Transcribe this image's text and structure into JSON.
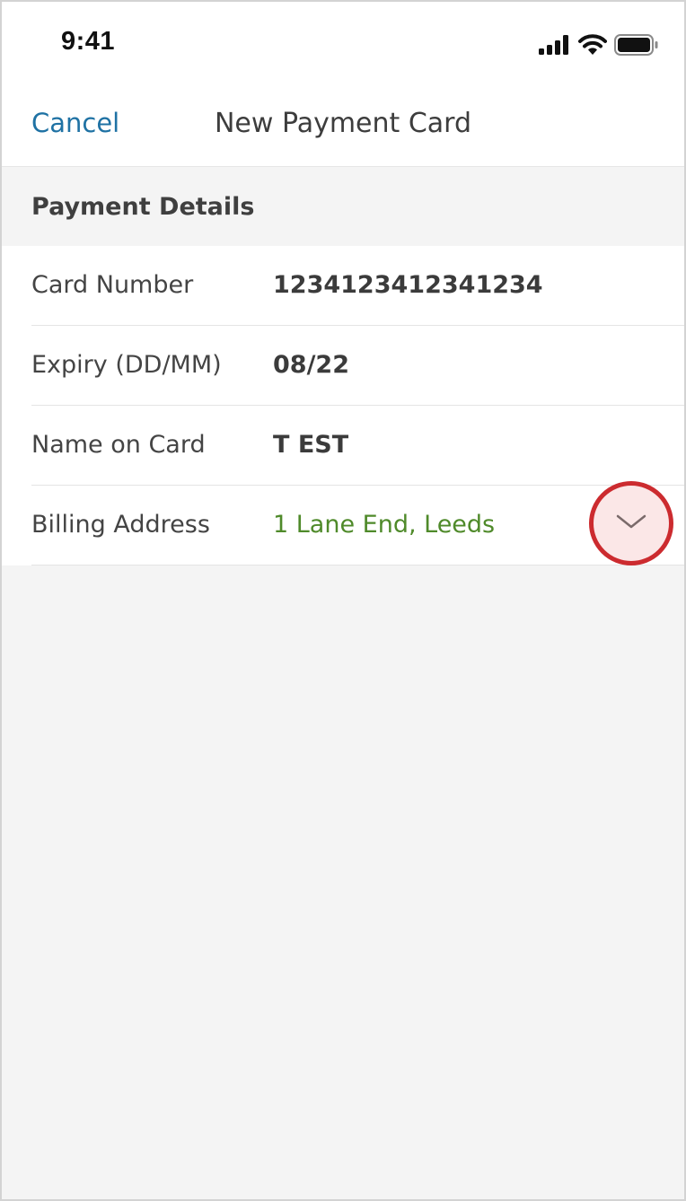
{
  "status_bar": {
    "time": "9:41",
    "icons": [
      "signal-icon",
      "wifi-icon",
      "battery-icon"
    ]
  },
  "nav": {
    "cancel_label": "Cancel",
    "title": "New Payment Card"
  },
  "section": {
    "title": "Payment Details"
  },
  "fields": [
    {
      "label": "Card Number",
      "value": "1234123412341234"
    },
    {
      "label": "Expiry (DD/MM)",
      "value": "08/22"
    },
    {
      "label": "Name on Card",
      "value": "T EST"
    },
    {
      "label": "Billing Address",
      "value": "1 Lane End, Leeds"
    }
  ],
  "billing_expand_icon": "chevron-down-icon",
  "colors": {
    "accent_blue": "#1f72a4",
    "address_green": "#4f8a2a",
    "highlight_red": "#cc2b2f",
    "highlight_fill": "#fbe7e7",
    "background_gray": "#f4f4f4"
  }
}
